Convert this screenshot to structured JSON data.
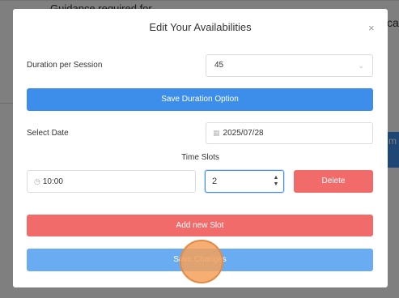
{
  "background": {
    "text": "Guidance required for",
    "right_text": "ca",
    "right_button": "m"
  },
  "modal": {
    "title": "Edit Your Availabilities",
    "close_icon": "×",
    "duration_label": "Duration per Session",
    "duration_value": "45",
    "save_duration_button": "Save Duration Option",
    "select_date_label": "Select Date",
    "date_value": "2025/07/28",
    "time_slots_label": "Time Slots",
    "slot": {
      "time": "10:00",
      "count": "2",
      "delete_button": "Delete"
    },
    "add_slot_button": "Add new Slot",
    "save_changes_button": "Save Changes"
  },
  "colors": {
    "primary": "#3d8eea",
    "danger": "#f26b6b",
    "primary_light": "#69acf2",
    "click_indicator": "#f4a05a"
  },
  "icons": {
    "calendar": "calendar-icon",
    "clock": "clock-icon",
    "chevron": "chevron-down-icon",
    "close": "close-icon"
  }
}
